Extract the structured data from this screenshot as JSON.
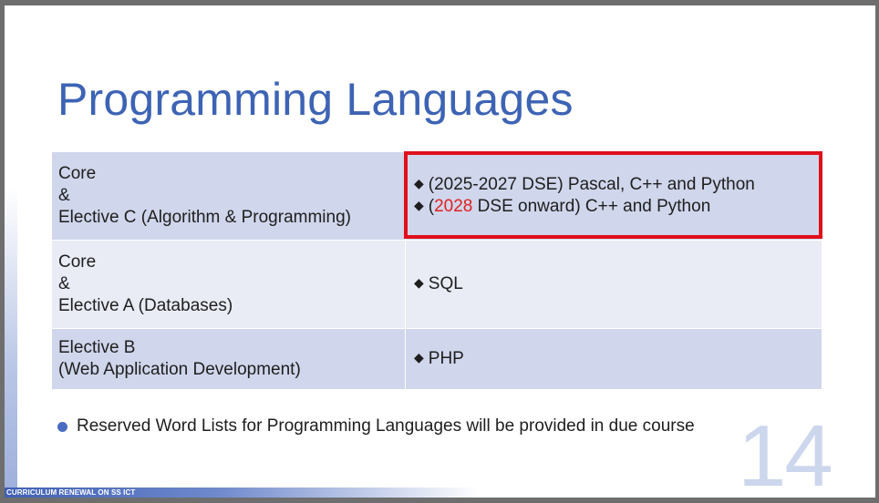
{
  "slide": {
    "title": "Programming Languages",
    "rows": [
      {
        "subject_lines": [
          "Core",
          "&",
          "Elective C (Algorithm & Programming)"
        ],
        "language_lines": [
          {
            "prefix": "(",
            "highlight": "",
            "text": "2025-2027 DSE) Pascal, C++ and Python"
          },
          {
            "prefix": "(",
            "highlight": "2028",
            "text": " DSE onward) C++ and Python"
          }
        ]
      },
      {
        "subject_lines": [
          "Core",
          "&",
          "Elective A (Databases)"
        ],
        "language_lines": [
          {
            "prefix": "",
            "highlight": "",
            "text": "SQL"
          }
        ]
      },
      {
        "subject_lines": [
          "Elective B",
          "(Web Application Development)"
        ],
        "language_lines": [
          {
            "prefix": "",
            "highlight": "",
            "text": "PHP"
          }
        ]
      }
    ],
    "note": "Reserved Word Lists for Programming Languages will be provided in due course",
    "page_number": "14",
    "footer": "CURRICULUM RENEWAL ON SS ICT",
    "diamond_glyph": "◆",
    "colors": {
      "title": "#3d63b4",
      "highlight_text": "#e02020",
      "highlight_box": "#e0101c",
      "row_dark": "#d0d6eb",
      "row_light": "#e9ecf5"
    }
  }
}
